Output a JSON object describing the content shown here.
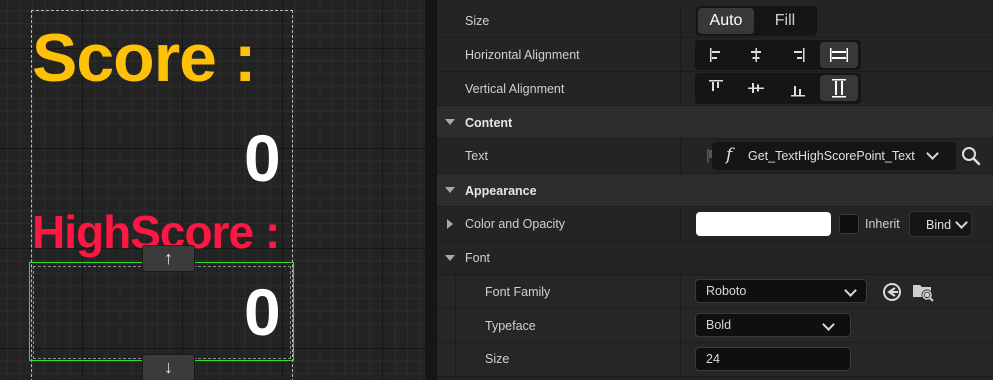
{
  "viewport": {
    "score_label": "Score :",
    "score_value": "0",
    "highscore_label": "HighScore :",
    "highscore_value": "0",
    "up_arrow": "↑",
    "down_arrow": "↓",
    "colors": {
      "score": "#ffc107",
      "highscore": "#ff1744",
      "value": "#ffffff",
      "selection": "#33dd33"
    }
  },
  "details": {
    "size": {
      "label": "Size",
      "options": [
        "Auto",
        "Fill"
      ],
      "selected": "Auto"
    },
    "horizontal_alignment": {
      "label": "Horizontal Alignment",
      "icons": [
        "align-left-icon",
        "align-center-icon",
        "align-right-icon",
        "align-fill-icon"
      ],
      "selected": "align-fill-icon"
    },
    "vertical_alignment": {
      "label": "Vertical Alignment",
      "icons": [
        "align-top-icon",
        "align-middle-icon",
        "align-bottom-icon",
        "align-fill-vertical-icon"
      ],
      "selected": "align-fill-vertical-icon"
    },
    "content_section": "Content",
    "text": {
      "label": "Text",
      "function_symbol": "f",
      "binding": "Get_TextHighScorePoint_Text"
    },
    "appearance_section": "Appearance",
    "color_opacity": {
      "label": "Color and Opacity",
      "color": "#ffffff",
      "inherit_label": "Inherit",
      "bind_label": "Bind"
    },
    "font_section": "Font",
    "font_family": {
      "label": "Font Family",
      "value": "Roboto"
    },
    "typeface": {
      "label": "Typeface",
      "value": "Bold"
    },
    "size_field": {
      "label": "Size",
      "value": "24"
    }
  }
}
